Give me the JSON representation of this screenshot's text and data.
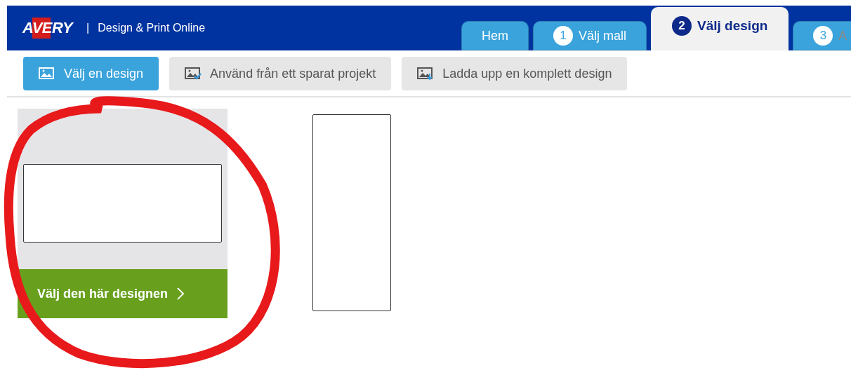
{
  "header": {
    "logo": "AVERY",
    "separator": "|",
    "title": "Design & Print Online"
  },
  "tabs": [
    {
      "label": "Hem",
      "selected": false
    },
    {
      "number": "1",
      "label": "Välj mall",
      "selected": false
    },
    {
      "number": "2",
      "label": "Välj design",
      "selected": true
    },
    {
      "number": "3",
      "label": "A",
      "selected": false
    }
  ],
  "toolbar": [
    {
      "label": "Välj en design",
      "selected": true,
      "kind": "image"
    },
    {
      "label": "Använd från ett sparat projekt",
      "selected": false,
      "kind": "saved"
    },
    {
      "label": "Ladda upp en komplett design",
      "selected": false,
      "kind": "upload"
    }
  ],
  "designs": [
    {
      "kind": "card",
      "button": "Välj den här designen"
    },
    {
      "kind": "outline"
    }
  ]
}
